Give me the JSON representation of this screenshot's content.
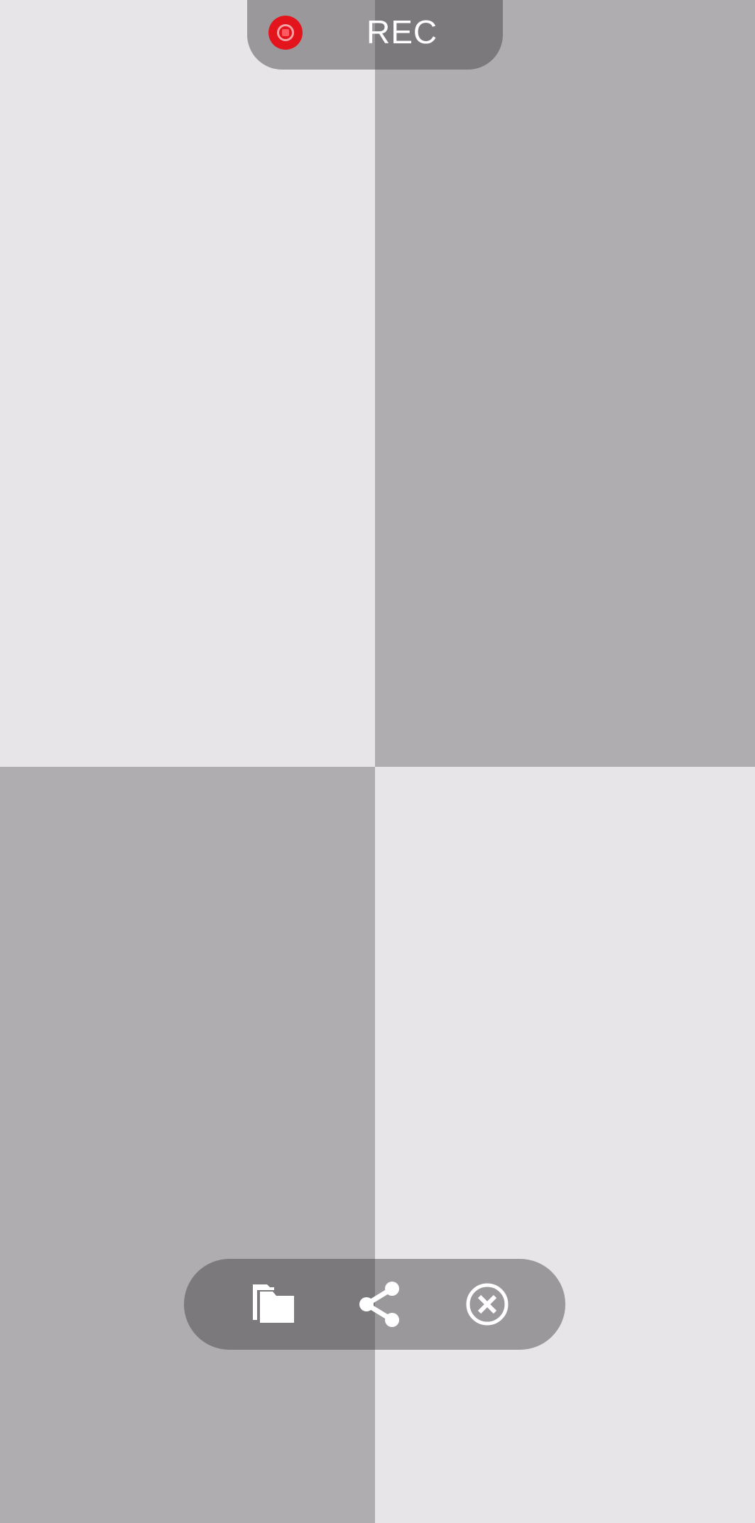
{
  "background": {
    "light_color": "#e7e5e8",
    "dark_color": "#afadb0"
  },
  "recording": {
    "label": "REC",
    "indicator_icon": "record-stop-icon",
    "indicator_color": "#e3141c"
  },
  "toolbar": {
    "buttons": [
      {
        "icon": "folder-icon"
      },
      {
        "icon": "share-icon"
      },
      {
        "icon": "close-circle-icon"
      }
    ]
  }
}
